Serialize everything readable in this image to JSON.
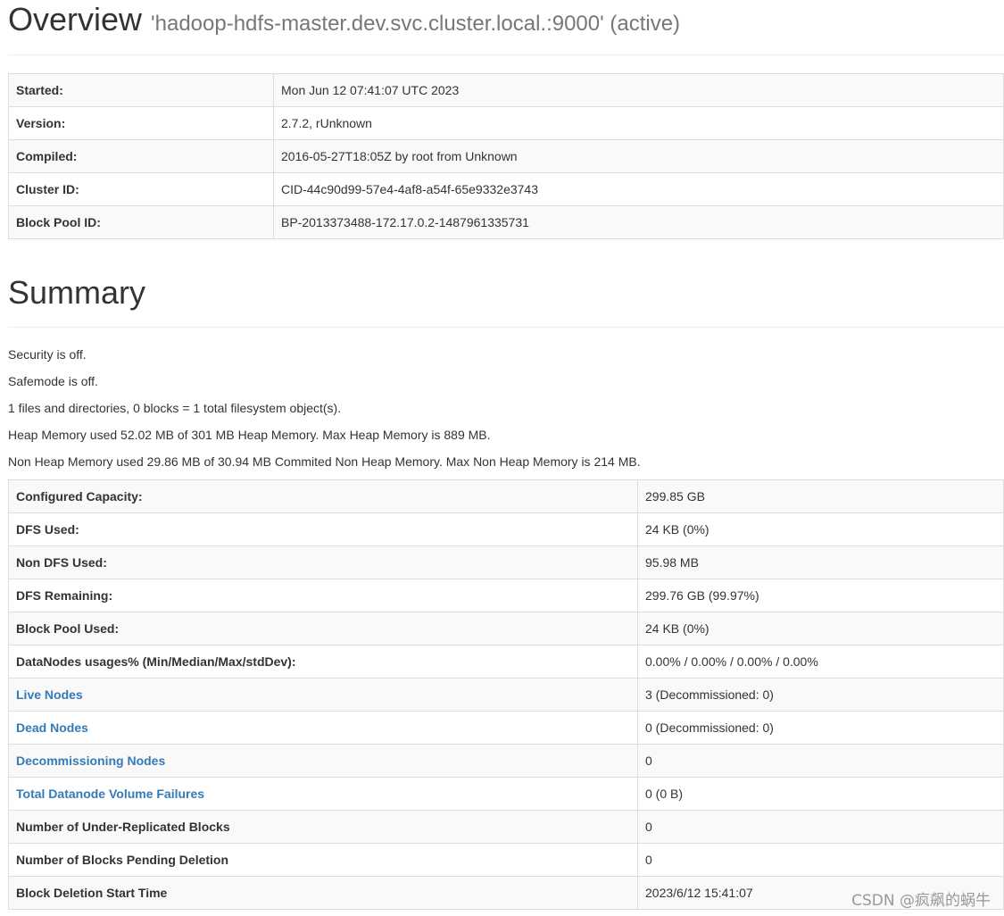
{
  "overview": {
    "title": "Overview",
    "subtitle": "'hadoop-hdfs-master.dev.svc.cluster.local.:9000' (active)",
    "rows": [
      {
        "label": "Started:",
        "value": "Mon Jun 12 07:41:07 UTC 2023"
      },
      {
        "label": "Version:",
        "value": "2.7.2, rUnknown"
      },
      {
        "label": "Compiled:",
        "value": "2016-05-27T18:05Z by root from Unknown"
      },
      {
        "label": "Cluster ID:",
        "value": "CID-44c90d99-57e4-4af8-a54f-65e9332e3743"
      },
      {
        "label": "Block Pool ID:",
        "value": "BP-2013373488-172.17.0.2-1487961335731"
      }
    ]
  },
  "summary": {
    "title": "Summary",
    "lines": [
      "Security is off.",
      "Safemode is off.",
      "1 files and directories, 0 blocks = 1 total filesystem object(s).",
      "Heap Memory used 52.02 MB of 301 MB Heap Memory. Max Heap Memory is 889 MB.",
      "Non Heap Memory used 29.86 MB of 30.94 MB Commited Non Heap Memory. Max Non Heap Memory is 214 MB."
    ],
    "rows": [
      {
        "label": "Configured Capacity:",
        "value": "299.85 GB"
      },
      {
        "label": "DFS Used:",
        "value": "24 KB (0%)"
      },
      {
        "label": "Non DFS Used:",
        "value": "95.98 MB"
      },
      {
        "label": "DFS Remaining:",
        "value": "299.76 GB (99.97%)"
      },
      {
        "label": "Block Pool Used:",
        "value": "24 KB (0%)"
      },
      {
        "label": "DataNodes usages% (Min/Median/Max/stdDev):",
        "value": "0.00% / 0.00% / 0.00% / 0.00%"
      },
      {
        "label": "Live Nodes",
        "value": "3 (Decommissioned: 0)"
      },
      {
        "label": "Dead Nodes",
        "value": "0 (Decommissioned: 0)"
      },
      {
        "label": "Decommissioning Nodes",
        "value": "0"
      },
      {
        "label": "Total Datanode Volume Failures",
        "value": "0 (0 B)"
      },
      {
        "label": "Number of Under-Replicated Blocks",
        "value": "0"
      },
      {
        "label": "Number of Blocks Pending Deletion",
        "value": "0"
      },
      {
        "label": "Block Deletion Start Time",
        "value": "2023/6/12 15:41:07"
      }
    ]
  },
  "watermark": "CSDN @疯飙的蜗牛",
  "colors": {
    "link": "#337ab7",
    "text": "#333333",
    "muted": "#777777",
    "stripe": "#f9f9f9",
    "border": "#dddddd"
  }
}
